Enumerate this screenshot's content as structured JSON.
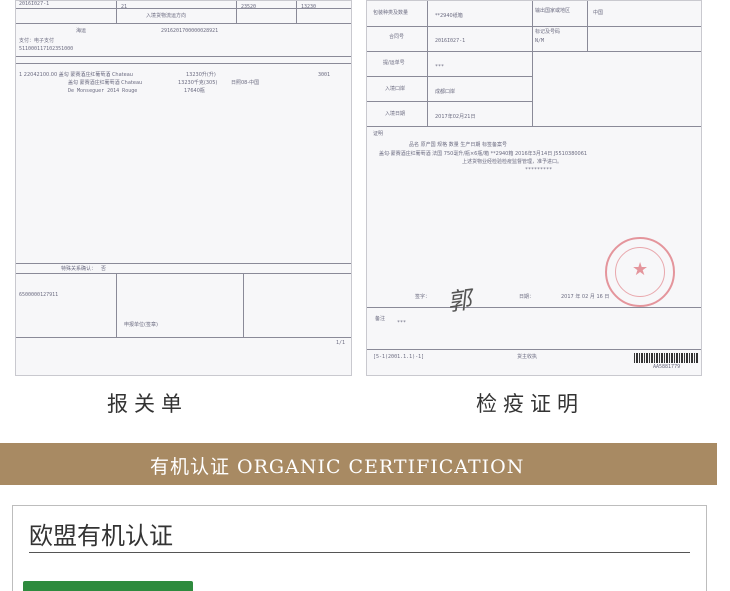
{
  "captions": {
    "left": "报关单",
    "right": "检疫证明"
  },
  "banner": {
    "title": "有机认证 ORGANIC CERTIFICATION"
  },
  "eu_section": {
    "title": "欧盟有机认证"
  },
  "customs": {
    "contract_no": "2016I027-1",
    "trade_row_a": "21",
    "trade_row_b": "入境货物流运方向",
    "num_a": "23520",
    "num_b": "13230",
    "transport": "海运",
    "no_full": "2916201700000028921",
    "pay_label": "支付：电子支付",
    "pay_no": "511000117102351000",
    "goods_line1": "1  22042100.00  盖勾 蒙赛酒庄红葡萄酒 Chateau",
    "goods_line2": "盖勾 蒙赛酒庄红葡萄酒 Chateau",
    "goods_line3": "De Monseguer 2014 Rouge",
    "qty_a": "13230升(升)",
    "qty_b": "13230千克(305)",
    "qty_c": "17640瓶",
    "trade_mode": "日照08-中国",
    "dest": "3001",
    "page": "1/1",
    "entry_code": "6500000127911",
    "sign_label": "特殊关系确认：",
    "confirm_no": "否",
    "unit_label": "申报单位(签章)"
  },
  "quarantine": {
    "pack_label": "包装种类及数量",
    "pack_value": "**2940纸箱",
    "origin_label": "输出国家或地区",
    "origin_value": "中国",
    "contract_label": "合同号",
    "contract_value": "2016I027-1",
    "mark_label": "标记及号码",
    "mark_value": "N/M",
    "bl_label": "提/运单号",
    "bl_value": "***",
    "port_label": "入境口岸",
    "port_value": "成都口岸",
    "date_label": "入境日期",
    "date_value": "2017年02月21日",
    "cert_label": "证明",
    "cert_headers": "品名        原产国        规格           数量        生产日期        标签备案号",
    "cert_row": "盖勾·蒙赛酒庄红葡萄酒    法国    750毫升/瓶×6瓶/箱   **2940箱   2016年3月14日   J5510380061",
    "cert_note": "上述货物业经检验检疫监督管理，准予进口。",
    "cert_stars": "*********",
    "sign_label": "签字：",
    "sign_date_label": "日期：",
    "sign_date": "2017  年  02  月  16  日",
    "remark_label": "备注",
    "remark_value": "***",
    "footer_left": "[5-1(2001.1.1)-1]",
    "footer_mid": "货主收执",
    "barcode_no": "AA5881779"
  }
}
